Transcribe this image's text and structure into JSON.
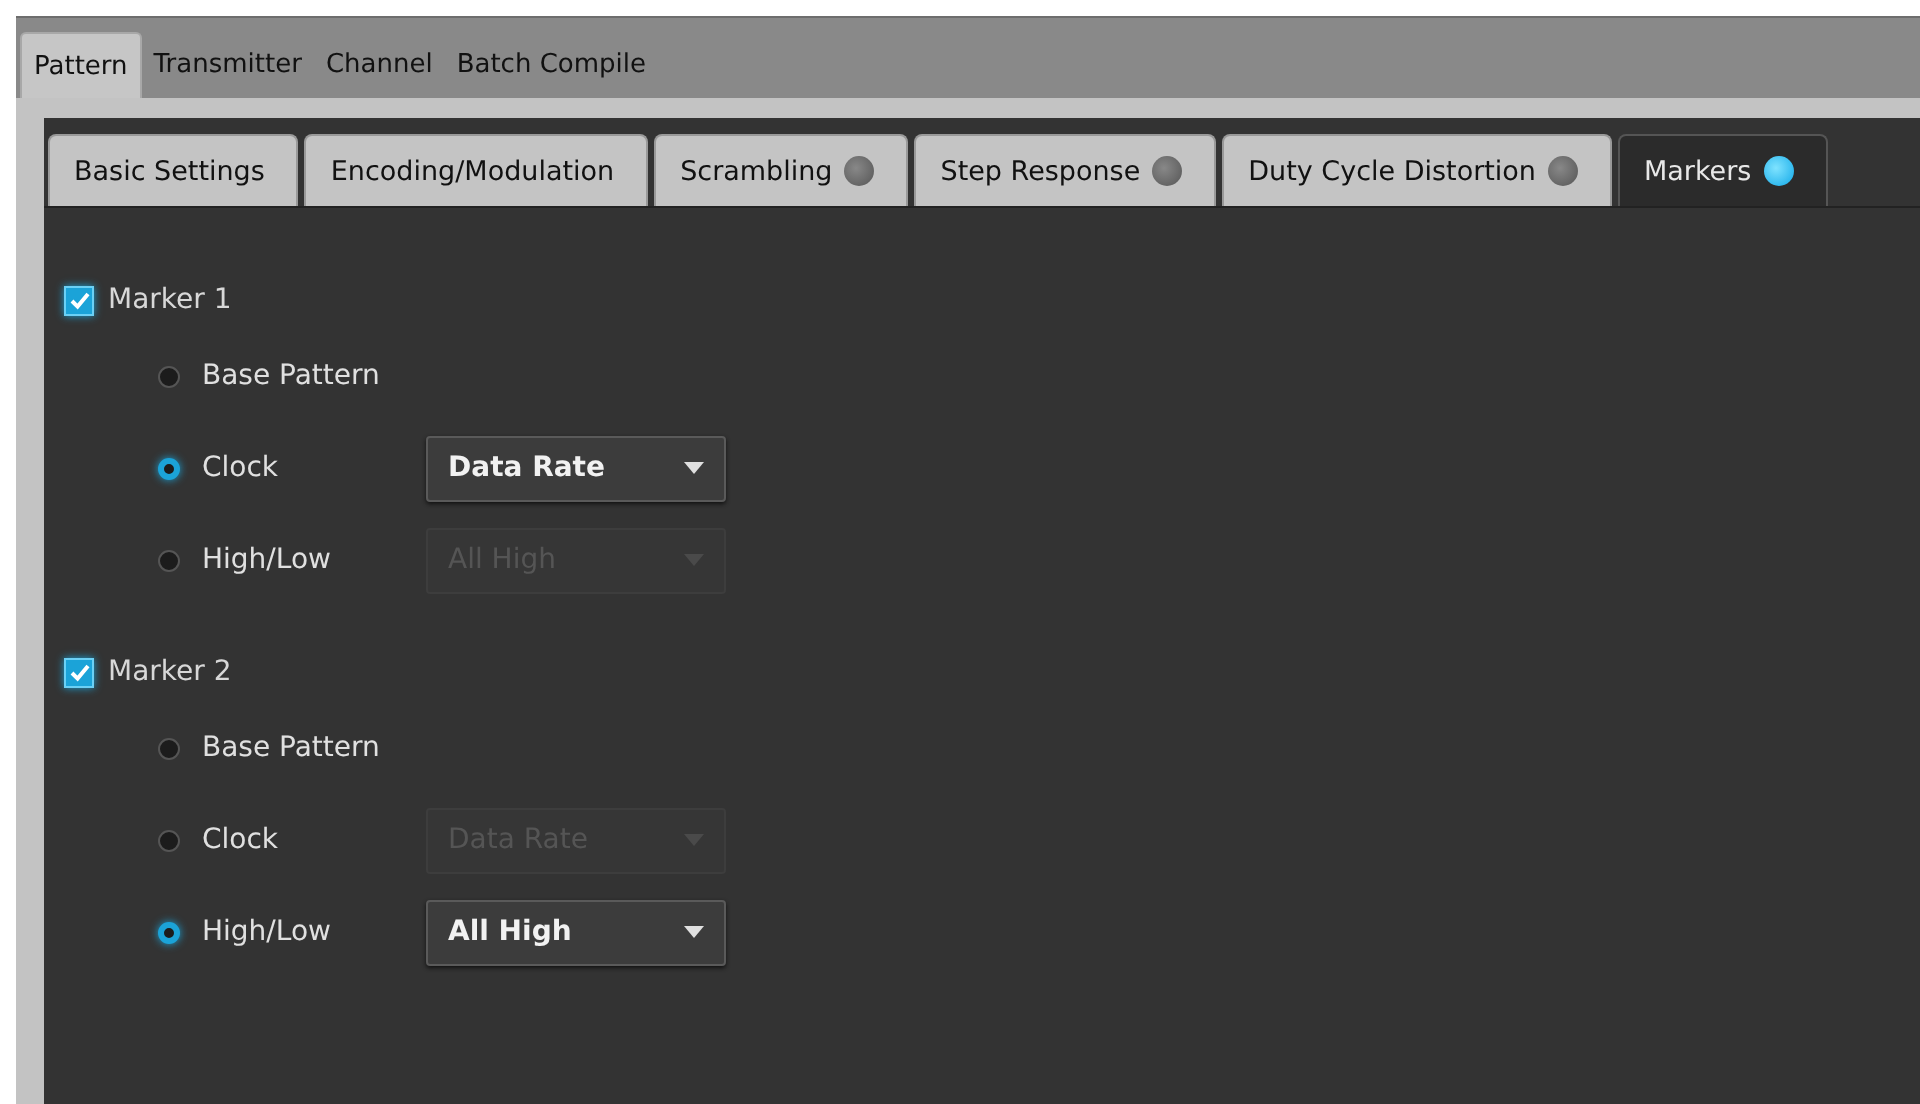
{
  "outer_tabs": [
    {
      "label": "Pattern",
      "selected": true
    },
    {
      "label": "Transmitter",
      "selected": false
    },
    {
      "label": "Channel",
      "selected": false
    },
    {
      "label": "Batch Compile",
      "selected": false
    }
  ],
  "inner_tabs": [
    {
      "label": "Basic Settings",
      "selected": false
    },
    {
      "label": "Encoding/Modulation",
      "selected": false
    },
    {
      "label": "Scrambling",
      "selected": false,
      "indicator": {
        "on": false
      }
    },
    {
      "label": "Step Response",
      "selected": false,
      "indicator": {
        "on": false
      }
    },
    {
      "label": "Duty Cycle Distortion",
      "selected": false,
      "indicator": {
        "on": false
      }
    },
    {
      "label": "Markers",
      "selected": true,
      "indicator": {
        "on": true
      }
    }
  ],
  "markers": [
    {
      "label": "Marker 1",
      "checked": true,
      "options": [
        {
          "label": "Base Pattern",
          "selected": false
        },
        {
          "label": "Clock",
          "selected": true,
          "dropdown": {
            "value": "Data Rate",
            "disabled": false
          }
        },
        {
          "label": "High/Low",
          "selected": false,
          "dropdown": {
            "value": "All High",
            "disabled": true
          }
        }
      ]
    },
    {
      "label": "Marker 2",
      "checked": true,
      "options": [
        {
          "label": "Base Pattern",
          "selected": false
        },
        {
          "label": "Clock",
          "selected": false,
          "dropdown": {
            "value": "Data Rate",
            "disabled": true
          }
        },
        {
          "label": "High/Low",
          "selected": true,
          "dropdown": {
            "value": "All High",
            "disabled": false
          }
        }
      ]
    }
  ]
}
